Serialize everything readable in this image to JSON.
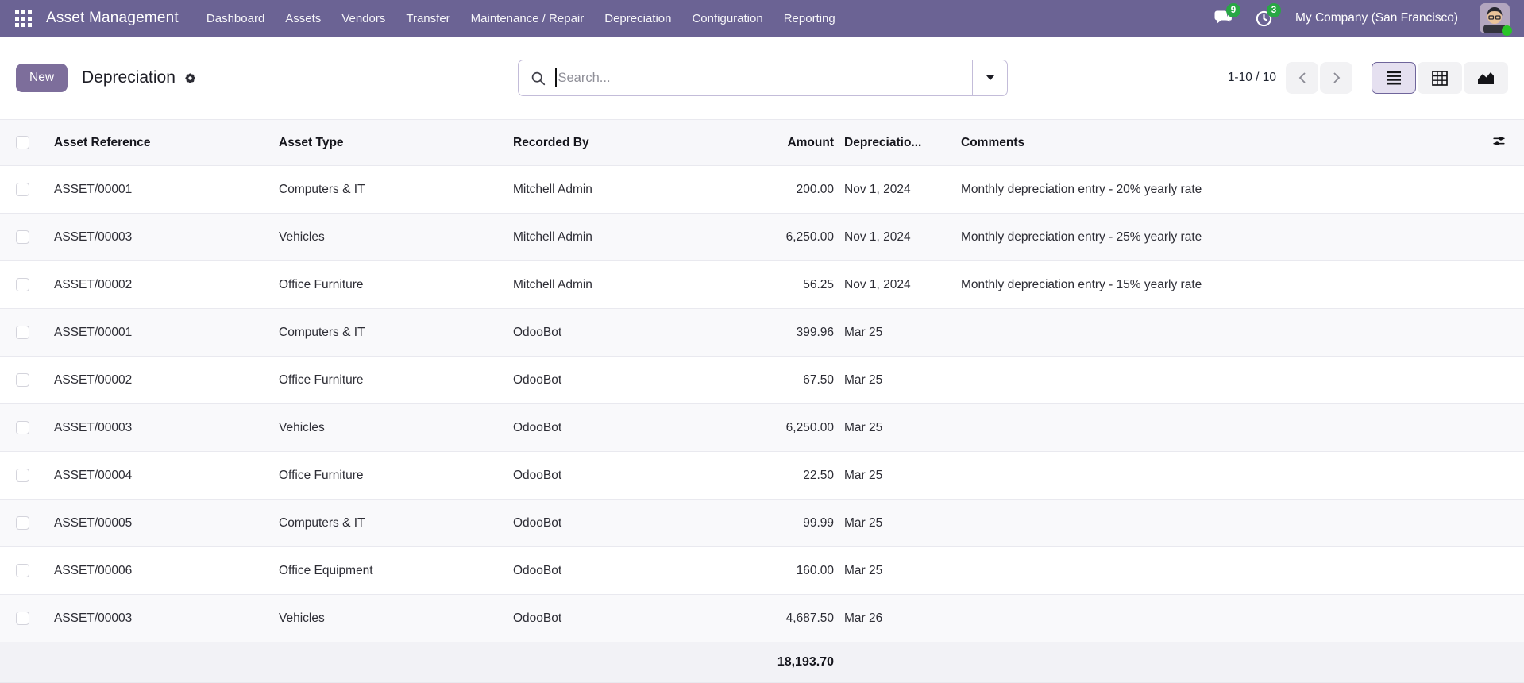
{
  "theme": {
    "navbar_bg": "#6b6394",
    "new_button_bg": "#7d6e9b",
    "badge_green": "#28a745",
    "active_view_bg": "#e5e0f0",
    "active_view_border": "#6f659b"
  },
  "navbar": {
    "brand": "Asset Management",
    "menu_items": [
      "Dashboard",
      "Assets",
      "Vendors",
      "Transfer",
      "Maintenance / Repair",
      "Depreciation",
      "Configuration",
      "Reporting"
    ],
    "messages_badge": "9",
    "activities_badge": "3",
    "company": "My Company (San Francisco)"
  },
  "control_panel": {
    "new_button": "New",
    "title": "Depreciation",
    "search_placeholder": "Search...",
    "pager_text": "1-10 / 10",
    "view_modes": [
      "list",
      "pivot",
      "graph"
    ],
    "active_view": "list"
  },
  "icons": {
    "apps-grid-icon": "3x3 white grid",
    "messages-icon": "chat bubbles",
    "activities-icon": "clock",
    "search-icon": "magnifier",
    "dropdown-caret-icon": "down triangle",
    "gear-icon": "cogwheel",
    "prev-icon": "chevron left",
    "next-icon": "chevron right",
    "list-view-icon": "horizontal bars",
    "pivot-view-icon": "grid table",
    "graph-view-icon": "area chart",
    "optional-columns-icon": "sliders"
  },
  "table": {
    "headers": [
      "Asset Reference",
      "Asset Type",
      "Recorded By",
      "Amount",
      "Depreciatio...",
      "Comments"
    ],
    "rows": [
      {
        "ref": "ASSET/00001",
        "type": "Computers & IT",
        "by": "Mitchell Admin",
        "amount": "200.00",
        "date": "Nov 1, 2024",
        "comments": "Monthly depreciation entry - 20% yearly rate"
      },
      {
        "ref": "ASSET/00003",
        "type": "Vehicles",
        "by": "Mitchell Admin",
        "amount": "6,250.00",
        "date": "Nov 1, 2024",
        "comments": "Monthly depreciation entry - 25% yearly rate"
      },
      {
        "ref": "ASSET/00002",
        "type": "Office Furniture",
        "by": "Mitchell Admin",
        "amount": "56.25",
        "date": "Nov 1, 2024",
        "comments": "Monthly depreciation entry - 15% yearly rate"
      },
      {
        "ref": "ASSET/00001",
        "type": "Computers & IT",
        "by": "OdooBot",
        "amount": "399.96",
        "date": "Mar 25",
        "comments": ""
      },
      {
        "ref": "ASSET/00002",
        "type": "Office Furniture",
        "by": "OdooBot",
        "amount": "67.50",
        "date": "Mar 25",
        "comments": ""
      },
      {
        "ref": "ASSET/00003",
        "type": "Vehicles",
        "by": "OdooBot",
        "amount": "6,250.00",
        "date": "Mar 25",
        "comments": ""
      },
      {
        "ref": "ASSET/00004",
        "type": "Office Furniture",
        "by": "OdooBot",
        "amount": "22.50",
        "date": "Mar 25",
        "comments": ""
      },
      {
        "ref": "ASSET/00005",
        "type": "Computers & IT",
        "by": "OdooBot",
        "amount": "99.99",
        "date": "Mar 25",
        "comments": ""
      },
      {
        "ref": "ASSET/00006",
        "type": "Office Equipment",
        "by": "OdooBot",
        "amount": "160.00",
        "date": "Mar 25",
        "comments": ""
      },
      {
        "ref": "ASSET/00003",
        "type": "Vehicles",
        "by": "OdooBot",
        "amount": "4,687.50",
        "date": "Mar 26",
        "comments": ""
      }
    ],
    "total": "18,193.70"
  }
}
